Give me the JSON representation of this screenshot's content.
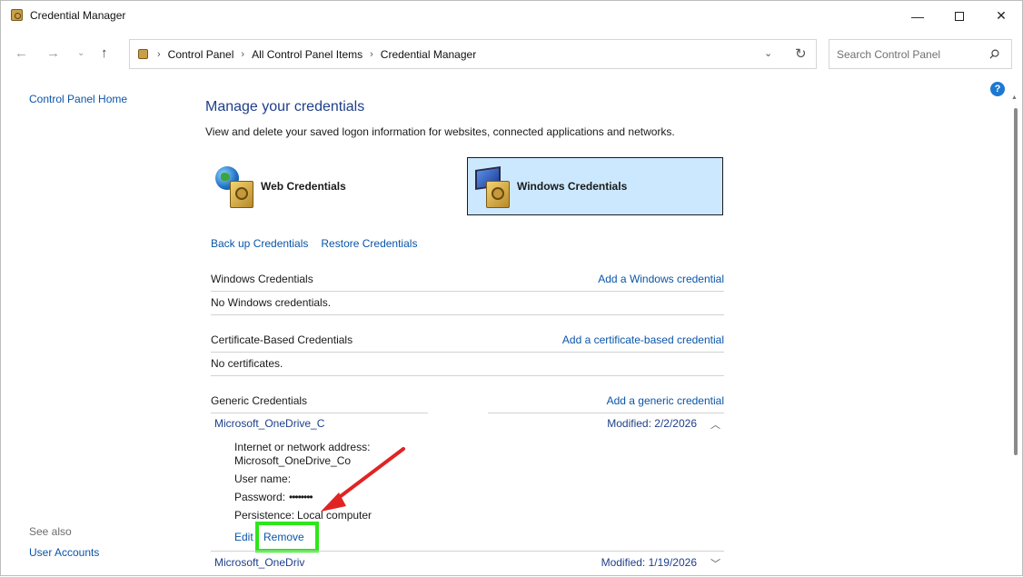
{
  "window": {
    "title": "Credential Manager",
    "controls": {
      "minimize": "—",
      "maximize": "",
      "close": "✕"
    }
  },
  "nav": {
    "back": "←",
    "forward": "→",
    "recent": "⌄",
    "up": "↑",
    "breadcrumbs": [
      "Control Panel",
      "All Control Panel Items",
      "Credential Manager"
    ],
    "separator": "›",
    "dropdown": "⌄",
    "refresh": "↻",
    "search_placeholder": "Search Control Panel"
  },
  "leftnav": {
    "home": "Control Panel Home",
    "see_also": "See also",
    "user_accounts": "User Accounts"
  },
  "help": "?",
  "main": {
    "title": "Manage your credentials",
    "description": "View and delete your saved logon information for websites, connected applications and networks.",
    "cred_types": [
      {
        "label": "Web Credentials",
        "selected": false
      },
      {
        "label": "Windows Credentials",
        "selected": true
      }
    ],
    "backup_link": "Back up Credentials",
    "restore_link": "Restore Credentials"
  },
  "sections": {
    "windows": {
      "label": "Windows Credentials",
      "action": "Add a Windows credential",
      "empty": "No Windows credentials."
    },
    "certificate": {
      "label": "Certificate-Based Credentials",
      "action": "Add a certificate-based credential",
      "empty": "No certificates."
    },
    "generic": {
      "label": "Generic Credentials",
      "action": "Add a generic credential",
      "items": [
        {
          "name": "Microsoft_OneDrive_C",
          "modified": "Modified:  2/2/2026",
          "chevron": "︿",
          "expanded": true,
          "details": {
            "address_label": "Internet or network address:",
            "address_value": "Microsoft_OneDrive_Co",
            "username_label": "User name:",
            "password_label": "Password:",
            "password_value": "••••••••",
            "persistence_label": "Persistence:",
            "persistence_value": "Local computer",
            "edit": "Edit",
            "remove": "Remove"
          }
        },
        {
          "name": "Microsoft_OneDriv",
          "modified": "Modified:  1/19/2026",
          "chevron": "﹀",
          "expanded": false
        }
      ]
    }
  },
  "colors": {
    "link": "#0a55a8",
    "title": "#1e3f8a",
    "selected_bg": "#cce8ff",
    "highlight_box": "#2ee61a",
    "arrow": "#e02424"
  }
}
